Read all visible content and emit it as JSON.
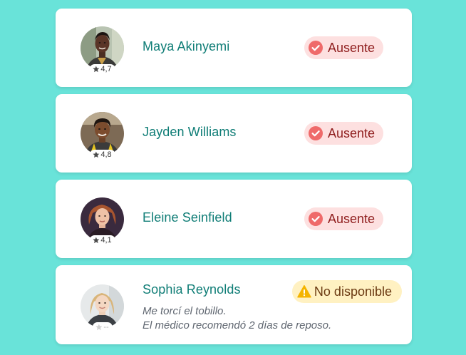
{
  "colors": {
    "background": "#69e3d9",
    "name": "#0f7d76",
    "absent_bg": "#fde0e0",
    "absent_text": "#8f1d1d",
    "absent_icon": "#ef6a6a",
    "unavailable_bg": "#fff1c2",
    "unavailable_text": "#6b3a12",
    "unavailable_icon": "#f4b400"
  },
  "people": [
    {
      "name": "Maya Akinyemi",
      "rating": "4,7",
      "status": "Ausente",
      "status_icon": "check-circle-icon",
      "avatar": "avatar-photo"
    },
    {
      "name": "Jayden Williams",
      "rating": "4,8",
      "status": "Ausente",
      "status_icon": "check-circle-icon",
      "avatar": "avatar-photo"
    },
    {
      "name": "Eleine Seinfield",
      "rating": "4,1",
      "status": "Ausente",
      "status_icon": "check-circle-icon",
      "avatar": "avatar-photo"
    },
    {
      "name": "Sophia Reynolds",
      "rating": "--",
      "status": "No disponible",
      "status_icon": "warning-triangle-icon",
      "avatar": "avatar-photo",
      "note_line1": "Me torcí el tobillo.",
      "note_line2": "El médico recomendó 2 días de reposo."
    }
  ]
}
